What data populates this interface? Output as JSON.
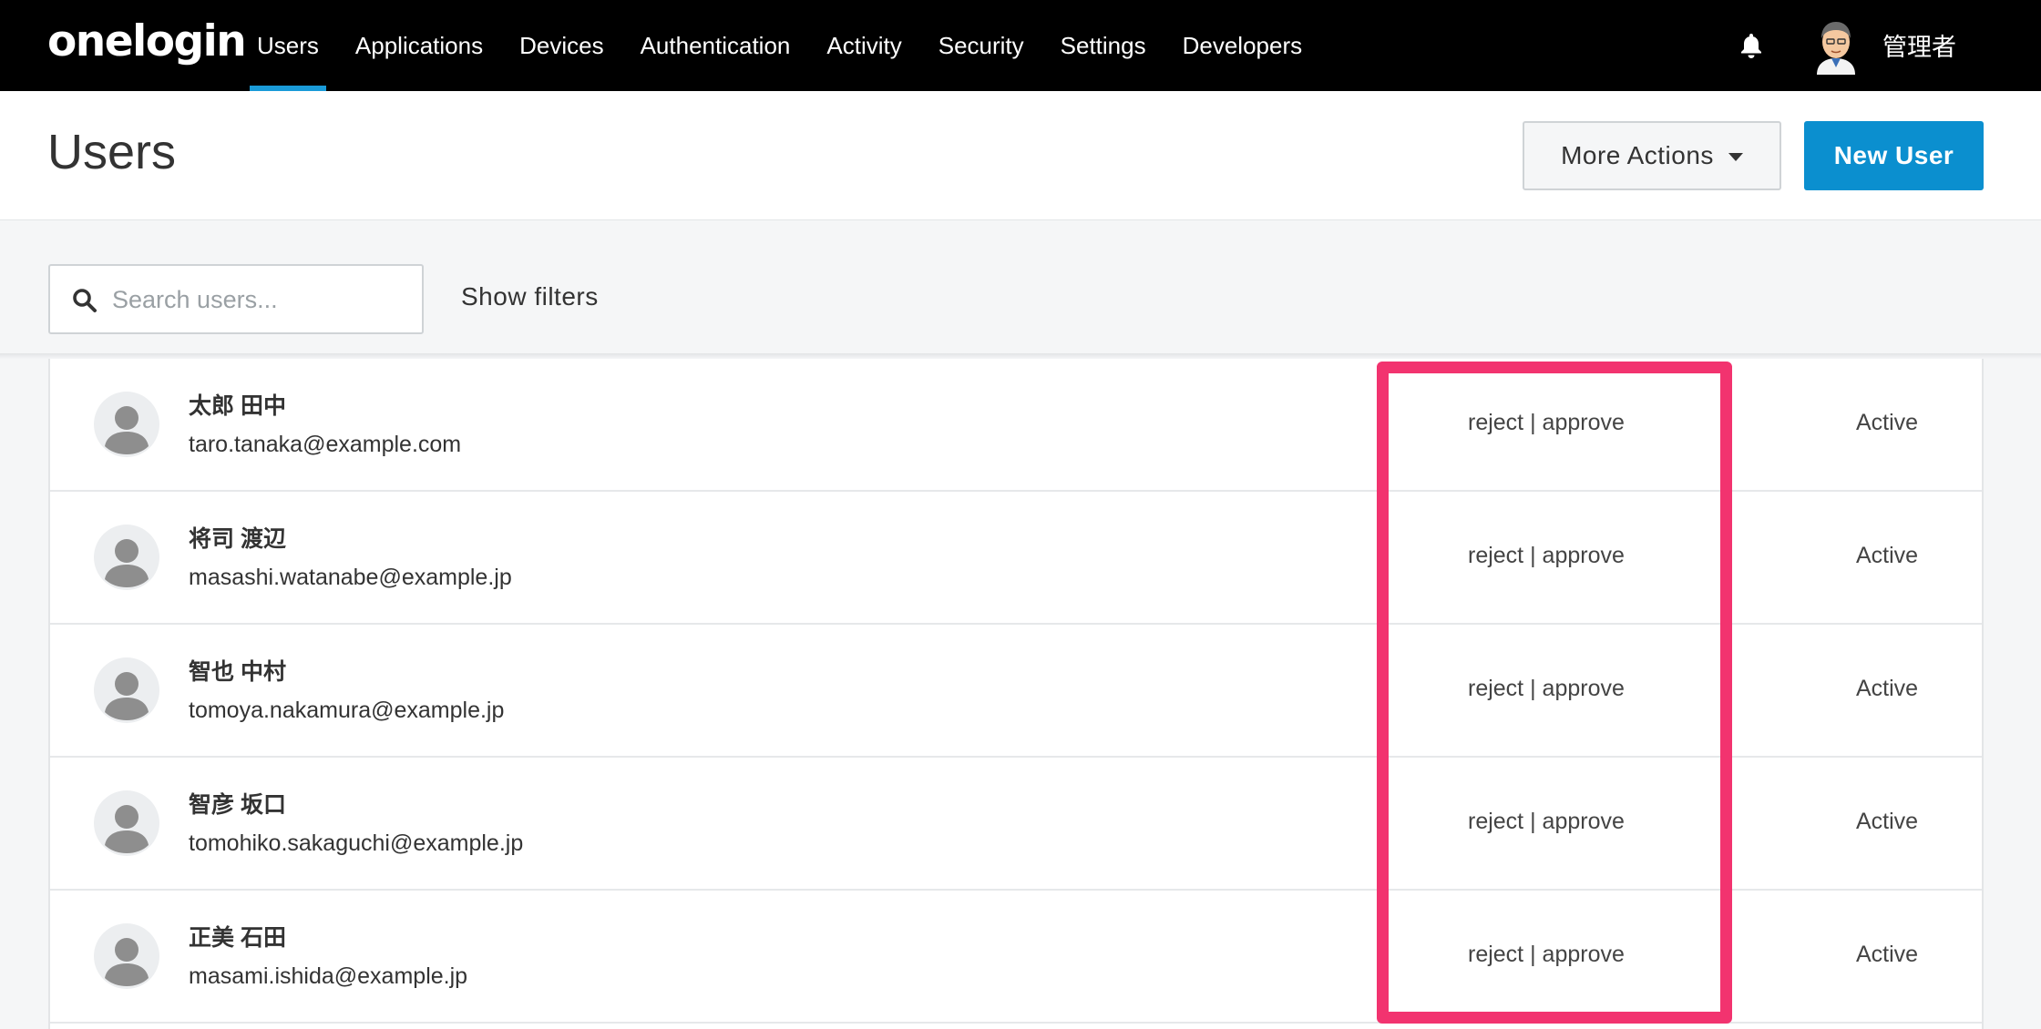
{
  "app": {
    "logo": "onelogin"
  },
  "nav": {
    "items": [
      {
        "label": "Users",
        "active": true
      },
      {
        "label": "Applications",
        "active": false
      },
      {
        "label": "Devices",
        "active": false
      },
      {
        "label": "Authentication",
        "active": false
      },
      {
        "label": "Activity",
        "active": false
      },
      {
        "label": "Security",
        "active": false
      },
      {
        "label": "Settings",
        "active": false
      },
      {
        "label": "Developers",
        "active": false
      }
    ],
    "user_name": "管理者"
  },
  "header": {
    "title": "Users",
    "more_actions_label": "More Actions",
    "new_user_label": "New User"
  },
  "search": {
    "placeholder": "Search users...",
    "value": "",
    "show_filters_label": "Show filters"
  },
  "users": [
    {
      "name": "太郎 田中",
      "email": "taro.tanaka@example.com",
      "reject_label": "reject",
      "separator": "|",
      "approve_label": "approve",
      "status": "Active"
    },
    {
      "name": "将司 渡辺",
      "email": "masashi.watanabe@example.jp",
      "reject_label": "reject",
      "separator": "|",
      "approve_label": "approve",
      "status": "Active"
    },
    {
      "name": "智也 中村",
      "email": "tomoya.nakamura@example.jp",
      "reject_label": "reject",
      "separator": "|",
      "approve_label": "approve",
      "status": "Active"
    },
    {
      "name": "智彦 坂口",
      "email": "tomohiko.sakaguchi@example.jp",
      "reject_label": "reject",
      "separator": "|",
      "approve_label": "approve",
      "status": "Active"
    },
    {
      "name": "正美 石田",
      "email": "masami.ishida@example.jp",
      "reject_label": "reject",
      "separator": "|",
      "approve_label": "approve",
      "status": "Active"
    }
  ],
  "colors": {
    "topbar": "#000000",
    "accent": "#1a9bd8",
    "primary_button": "#0b8fcf",
    "highlight": "#f2336f"
  },
  "icons": {
    "bell": "bell-icon",
    "search": "search-icon",
    "user_avatar": "user-placeholder-icon"
  }
}
